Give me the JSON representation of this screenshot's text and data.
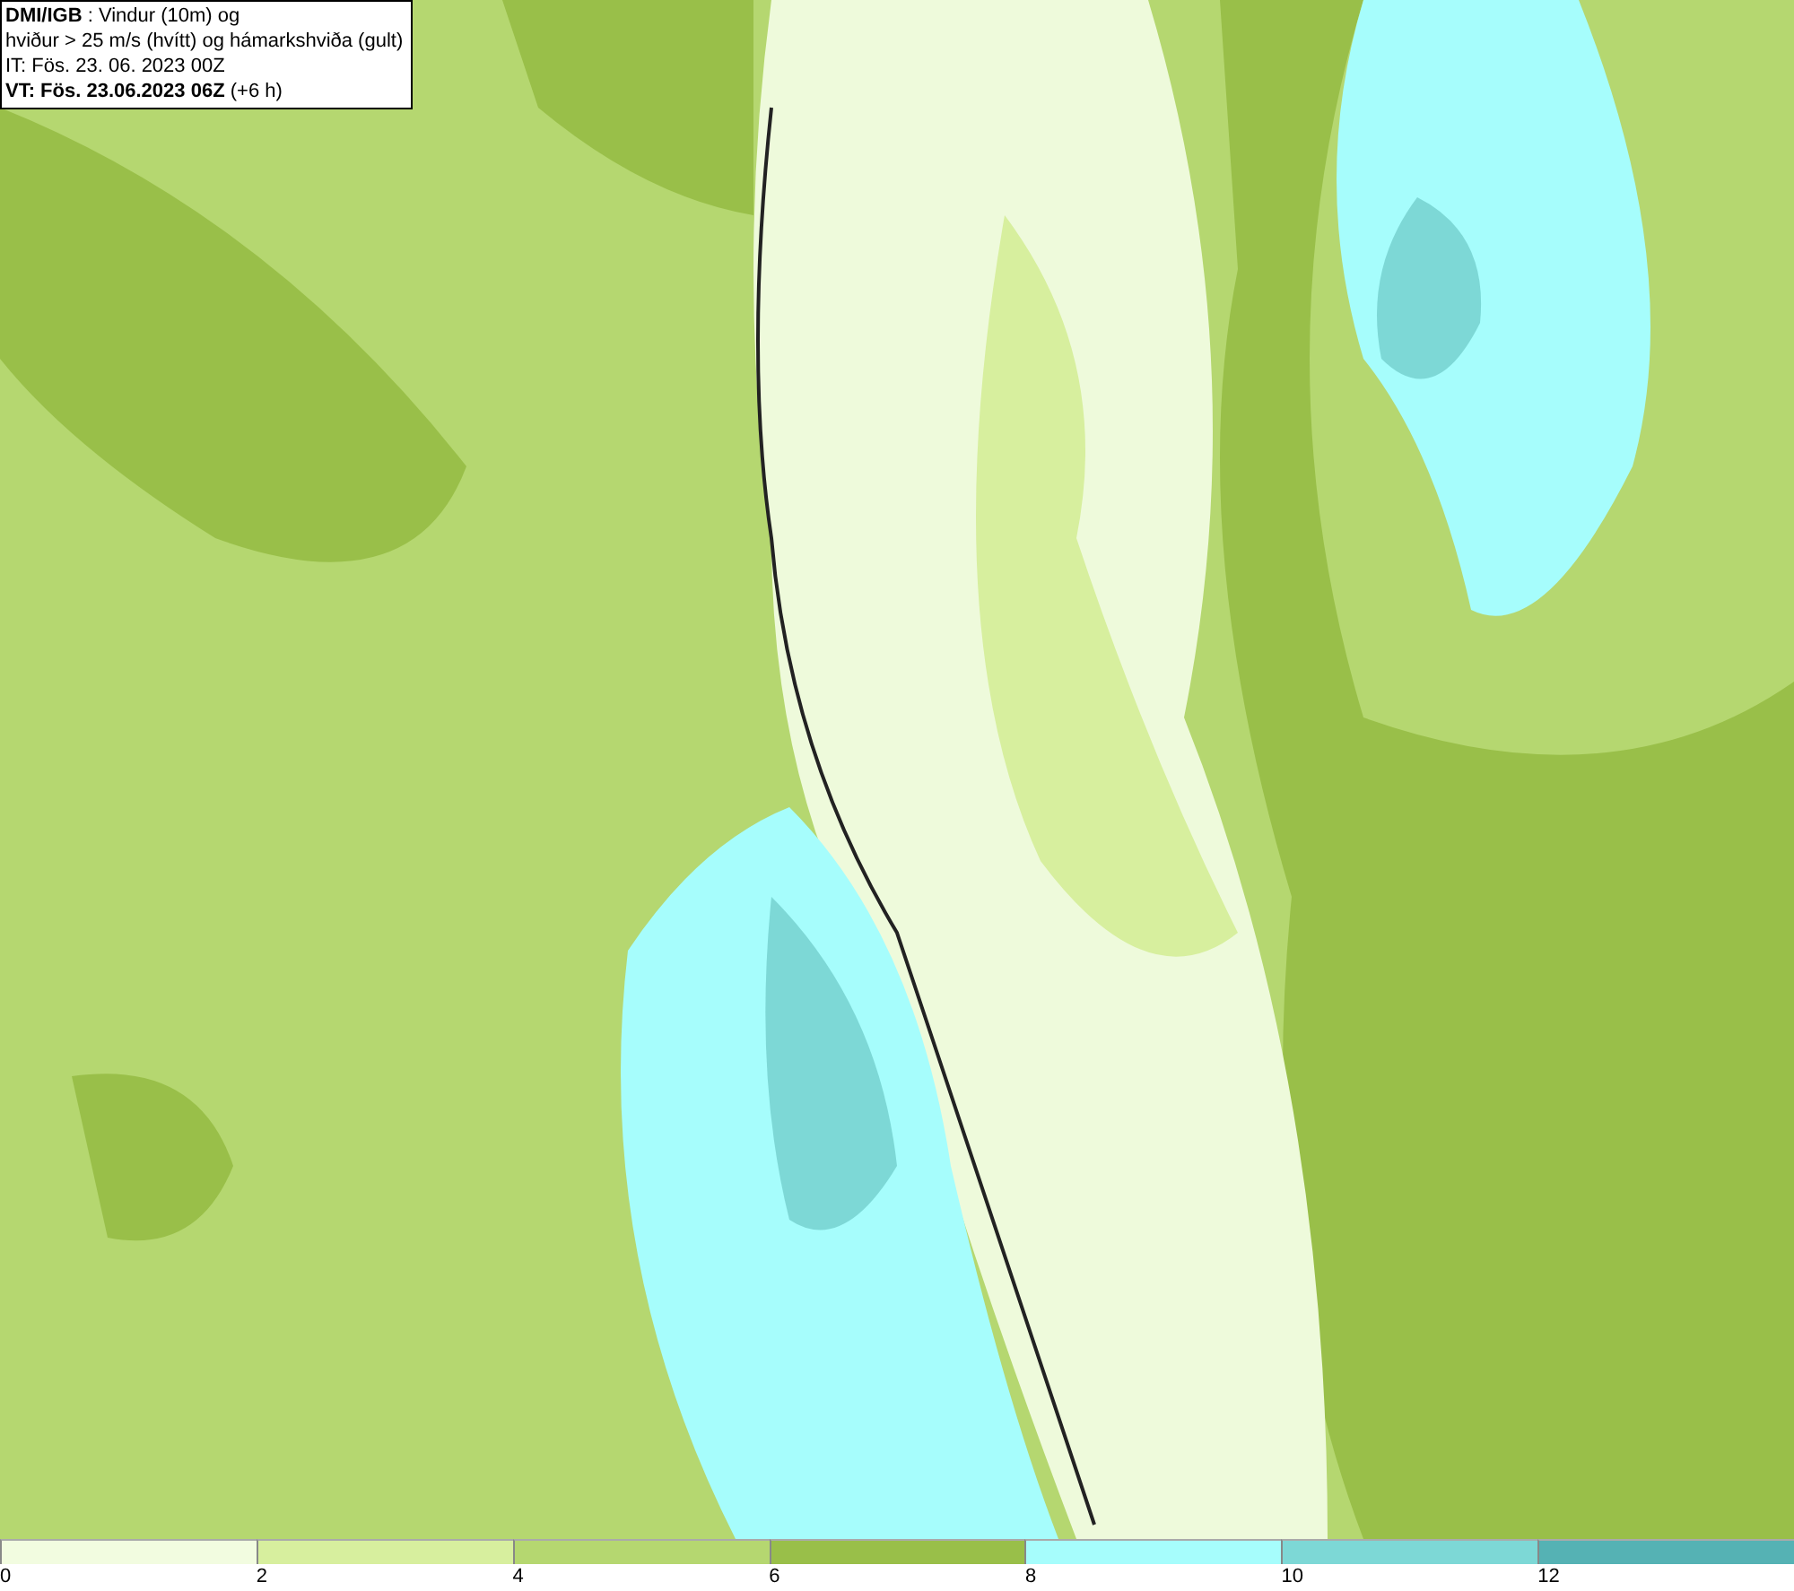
{
  "info_box": {
    "lines": [
      "**DMI/IGB** : Vindur (10m) og",
      "hviður > 25 m/s (hvítt) og hámarkshviða (gult)",
      "IT: Fös. 23. 06. 2023 00Z",
      "**VT: Fös. 23.06.2023 06Z** (+6 h)"
    ]
  },
  "legend": [
    {
      "label": "0",
      "color": "#f2fce0"
    },
    {
      "label": "2",
      "color": "#d7ef9e"
    },
    {
      "label": "4",
      "color": "#b5d770"
    },
    {
      "label": "6",
      "color": "#99bf49"
    },
    {
      "label": "8",
      "color": "#a6fdfc"
    },
    {
      "label": "10",
      "color": "#7dd8d6"
    },
    {
      "label": "12",
      "color": "#55b2b4"
    }
  ]
}
